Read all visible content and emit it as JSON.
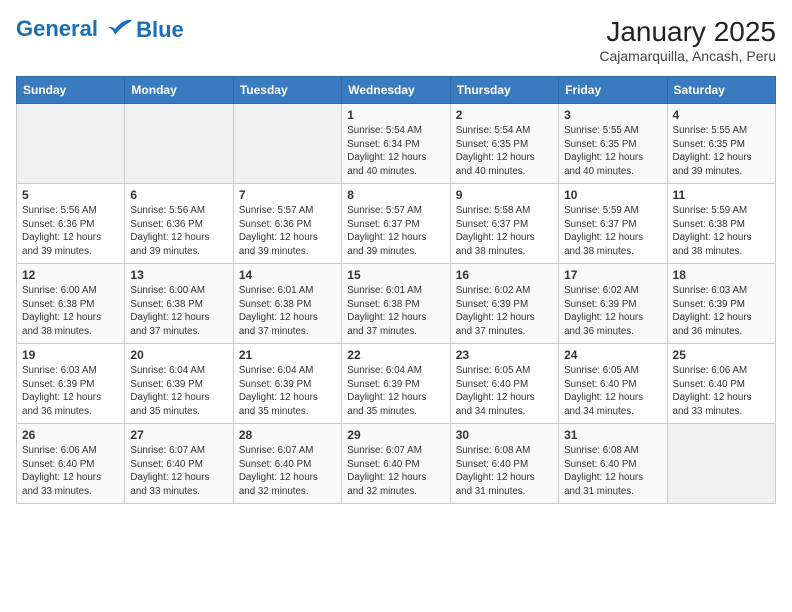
{
  "header": {
    "logo_line1": "General",
    "logo_line2": "Blue",
    "title": "January 2025",
    "subtitle": "Cajamarquilla, Ancash, Peru"
  },
  "calendar": {
    "days_of_week": [
      "Sunday",
      "Monday",
      "Tuesday",
      "Wednesday",
      "Thursday",
      "Friday",
      "Saturday"
    ],
    "weeks": [
      [
        {
          "day": "",
          "info": ""
        },
        {
          "day": "",
          "info": ""
        },
        {
          "day": "",
          "info": ""
        },
        {
          "day": "1",
          "info": "Sunrise: 5:54 AM\nSunset: 6:34 PM\nDaylight: 12 hours\nand 40 minutes."
        },
        {
          "day": "2",
          "info": "Sunrise: 5:54 AM\nSunset: 6:35 PM\nDaylight: 12 hours\nand 40 minutes."
        },
        {
          "day": "3",
          "info": "Sunrise: 5:55 AM\nSunset: 6:35 PM\nDaylight: 12 hours\nand 40 minutes."
        },
        {
          "day": "4",
          "info": "Sunrise: 5:55 AM\nSunset: 6:35 PM\nDaylight: 12 hours\nand 39 minutes."
        }
      ],
      [
        {
          "day": "5",
          "info": "Sunrise: 5:56 AM\nSunset: 6:36 PM\nDaylight: 12 hours\nand 39 minutes."
        },
        {
          "day": "6",
          "info": "Sunrise: 5:56 AM\nSunset: 6:36 PM\nDaylight: 12 hours\nand 39 minutes."
        },
        {
          "day": "7",
          "info": "Sunrise: 5:57 AM\nSunset: 6:36 PM\nDaylight: 12 hours\nand 39 minutes."
        },
        {
          "day": "8",
          "info": "Sunrise: 5:57 AM\nSunset: 6:37 PM\nDaylight: 12 hours\nand 39 minutes."
        },
        {
          "day": "9",
          "info": "Sunrise: 5:58 AM\nSunset: 6:37 PM\nDaylight: 12 hours\nand 38 minutes."
        },
        {
          "day": "10",
          "info": "Sunrise: 5:59 AM\nSunset: 6:37 PM\nDaylight: 12 hours\nand 38 minutes."
        },
        {
          "day": "11",
          "info": "Sunrise: 5:59 AM\nSunset: 6:38 PM\nDaylight: 12 hours\nand 38 minutes."
        }
      ],
      [
        {
          "day": "12",
          "info": "Sunrise: 6:00 AM\nSunset: 6:38 PM\nDaylight: 12 hours\nand 38 minutes."
        },
        {
          "day": "13",
          "info": "Sunrise: 6:00 AM\nSunset: 6:38 PM\nDaylight: 12 hours\nand 37 minutes."
        },
        {
          "day": "14",
          "info": "Sunrise: 6:01 AM\nSunset: 6:38 PM\nDaylight: 12 hours\nand 37 minutes."
        },
        {
          "day": "15",
          "info": "Sunrise: 6:01 AM\nSunset: 6:38 PM\nDaylight: 12 hours\nand 37 minutes."
        },
        {
          "day": "16",
          "info": "Sunrise: 6:02 AM\nSunset: 6:39 PM\nDaylight: 12 hours\nand 37 minutes."
        },
        {
          "day": "17",
          "info": "Sunrise: 6:02 AM\nSunset: 6:39 PM\nDaylight: 12 hours\nand 36 minutes."
        },
        {
          "day": "18",
          "info": "Sunrise: 6:03 AM\nSunset: 6:39 PM\nDaylight: 12 hours\nand 36 minutes."
        }
      ],
      [
        {
          "day": "19",
          "info": "Sunrise: 6:03 AM\nSunset: 6:39 PM\nDaylight: 12 hours\nand 36 minutes."
        },
        {
          "day": "20",
          "info": "Sunrise: 6:04 AM\nSunset: 6:39 PM\nDaylight: 12 hours\nand 35 minutes."
        },
        {
          "day": "21",
          "info": "Sunrise: 6:04 AM\nSunset: 6:39 PM\nDaylight: 12 hours\nand 35 minutes."
        },
        {
          "day": "22",
          "info": "Sunrise: 6:04 AM\nSunset: 6:39 PM\nDaylight: 12 hours\nand 35 minutes."
        },
        {
          "day": "23",
          "info": "Sunrise: 6:05 AM\nSunset: 6:40 PM\nDaylight: 12 hours\nand 34 minutes."
        },
        {
          "day": "24",
          "info": "Sunrise: 6:05 AM\nSunset: 6:40 PM\nDaylight: 12 hours\nand 34 minutes."
        },
        {
          "day": "25",
          "info": "Sunrise: 6:06 AM\nSunset: 6:40 PM\nDaylight: 12 hours\nand 33 minutes."
        }
      ],
      [
        {
          "day": "26",
          "info": "Sunrise: 6:06 AM\nSunset: 6:40 PM\nDaylight: 12 hours\nand 33 minutes."
        },
        {
          "day": "27",
          "info": "Sunrise: 6:07 AM\nSunset: 6:40 PM\nDaylight: 12 hours\nand 33 minutes."
        },
        {
          "day": "28",
          "info": "Sunrise: 6:07 AM\nSunset: 6:40 PM\nDaylight: 12 hours\nand 32 minutes."
        },
        {
          "day": "29",
          "info": "Sunrise: 6:07 AM\nSunset: 6:40 PM\nDaylight: 12 hours\nand 32 minutes."
        },
        {
          "day": "30",
          "info": "Sunrise: 6:08 AM\nSunset: 6:40 PM\nDaylight: 12 hours\nand 31 minutes."
        },
        {
          "day": "31",
          "info": "Sunrise: 6:08 AM\nSunset: 6:40 PM\nDaylight: 12 hours\nand 31 minutes."
        },
        {
          "day": "",
          "info": ""
        }
      ]
    ]
  }
}
